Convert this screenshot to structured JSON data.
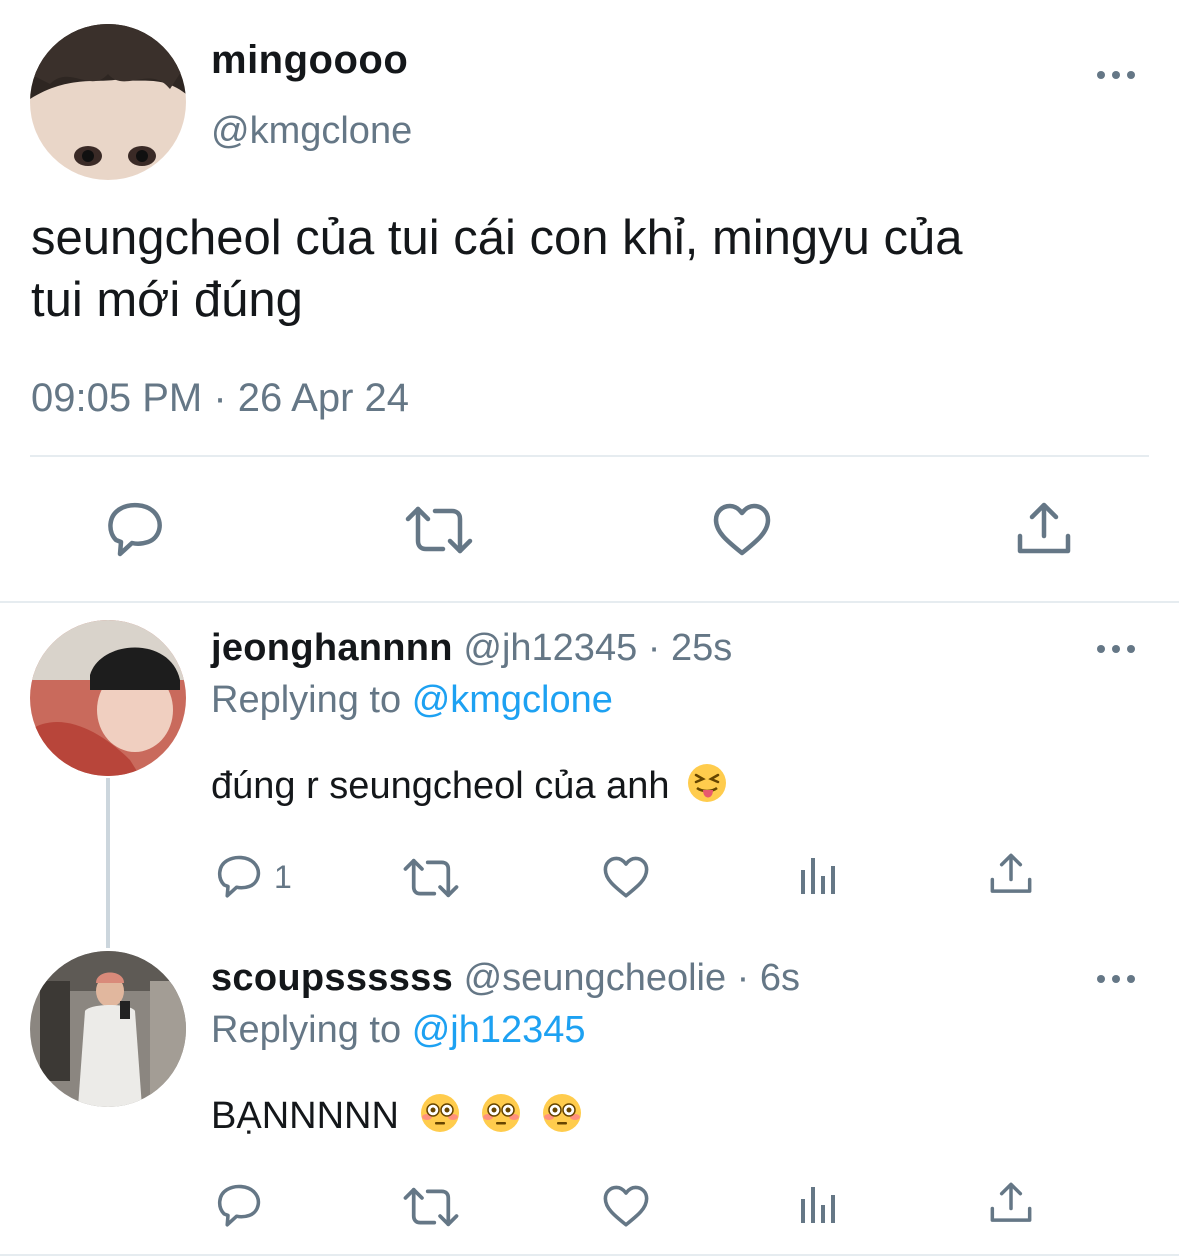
{
  "main_tweet": {
    "display_name": "mingoooo",
    "handle": "@kmgclone",
    "text_line1": "seungcheol của tui cái con khỉ, mingyu của",
    "text_line2": "tui mới đúng",
    "timestamp": "09:05 PM · 26 Apr 24",
    "actions": [
      "reply-icon",
      "retweet-icon",
      "like-icon",
      "share-icon"
    ]
  },
  "replies": [
    {
      "display_name": "jeonghannnn",
      "handle": "@jh12345",
      "time": "· 25s",
      "replying_prefix": "Replying to",
      "replying_to": "@kmgclone",
      "text": "đúng r seungcheol của anh",
      "emoji": [
        "squinting-tongue-emoji"
      ],
      "reply_count": "1"
    },
    {
      "display_name": "scoupssssss",
      "handle": "@seungcheolie",
      "time": "· 6s",
      "replying_prefix": "Replying to",
      "replying_to": "@jh12345",
      "text": "BẠNNNNN",
      "emoji": [
        "flushed-face-emoji",
        "flushed-face-emoji",
        "flushed-face-emoji"
      ],
      "reply_count": ""
    }
  ],
  "colors": {
    "primary_text": "#14171a",
    "secondary_text": "#657786",
    "link": "#1da1f2",
    "divider": "#e6ecf0"
  }
}
